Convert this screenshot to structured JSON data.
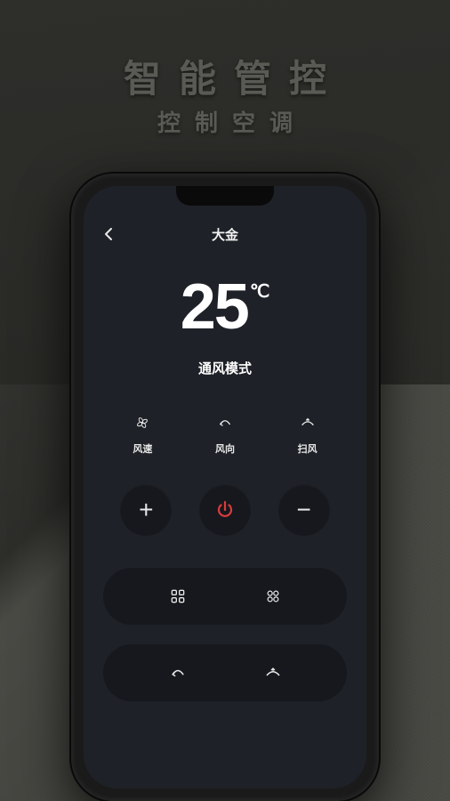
{
  "hero": {
    "title": "智能管控",
    "subtitle": "控制空调"
  },
  "header": {
    "title": "大金"
  },
  "temperature": {
    "value": "25",
    "unit": "℃"
  },
  "mode": {
    "label": "通风模式"
  },
  "controls": [
    {
      "icon": "fan-speed-icon",
      "label": "风速"
    },
    {
      "icon": "wind-direction-icon",
      "label": "风向"
    },
    {
      "icon": "swing-icon",
      "label": "扫风"
    }
  ],
  "circleButtons": {
    "increase": "+",
    "power": "power",
    "decrease": "−"
  },
  "pillRow1": {
    "left": "grid-icon",
    "right": "fan-icon"
  },
  "pillRow2": {
    "left": "wind-direction-icon",
    "right": "swing-icon"
  }
}
